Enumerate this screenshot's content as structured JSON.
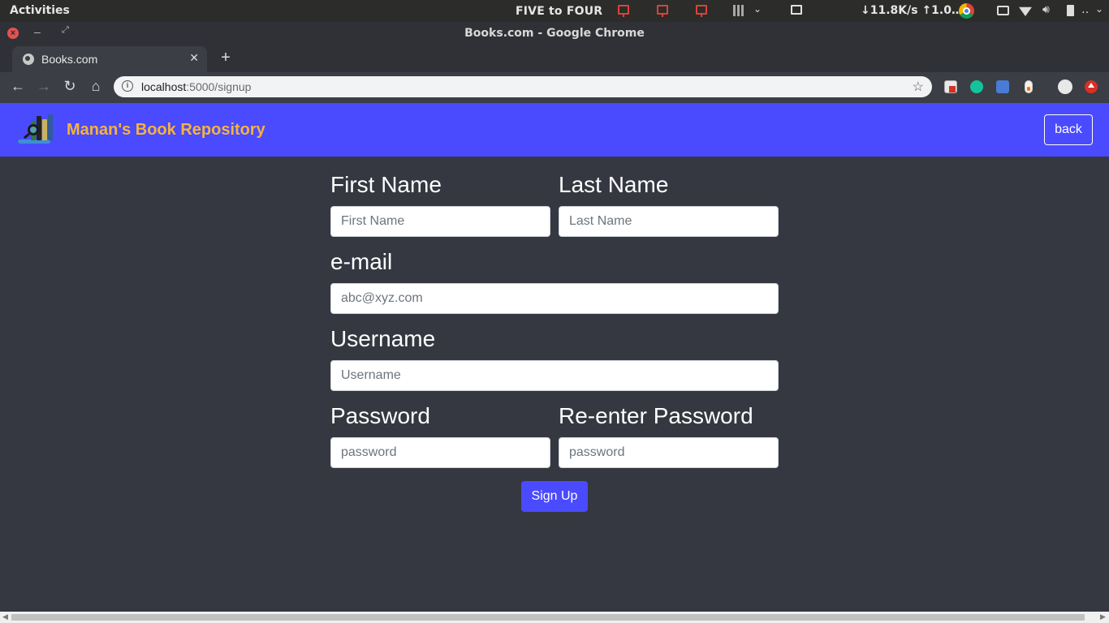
{
  "system": {
    "activities": "Activities",
    "center_text": "FIVE to FOUR",
    "net_speed": "↓11.8K/s ↑1.0…",
    "more": "‥"
  },
  "window": {
    "title": "Books.com - Google Chrome"
  },
  "tab": {
    "title": "Books.com"
  },
  "omnibox": {
    "host": "localhost",
    "path": ":5000/signup"
  },
  "navbar": {
    "brand": "Manan's Book Repository",
    "back_label": "back",
    "bg_color": "#4a4aff",
    "brand_color": "#f5b33a"
  },
  "form": {
    "first_name": {
      "label": "First Name",
      "placeholder": "First Name"
    },
    "last_name": {
      "label": "Last Name",
      "placeholder": "Last Name"
    },
    "email": {
      "label": "e-mail",
      "placeholder": "abc@xyz.com"
    },
    "username": {
      "label": "Username",
      "placeholder": "Username"
    },
    "password": {
      "label": "Password",
      "placeholder": "password"
    },
    "reenter_password": {
      "label": "Re-enter Password",
      "placeholder": "password"
    },
    "submit_label": "Sign Up"
  },
  "icons": {
    "nav_back": "arrow-left",
    "nav_forward": "arrow-right",
    "reload": "reload",
    "home": "home",
    "bookmark": "star"
  }
}
